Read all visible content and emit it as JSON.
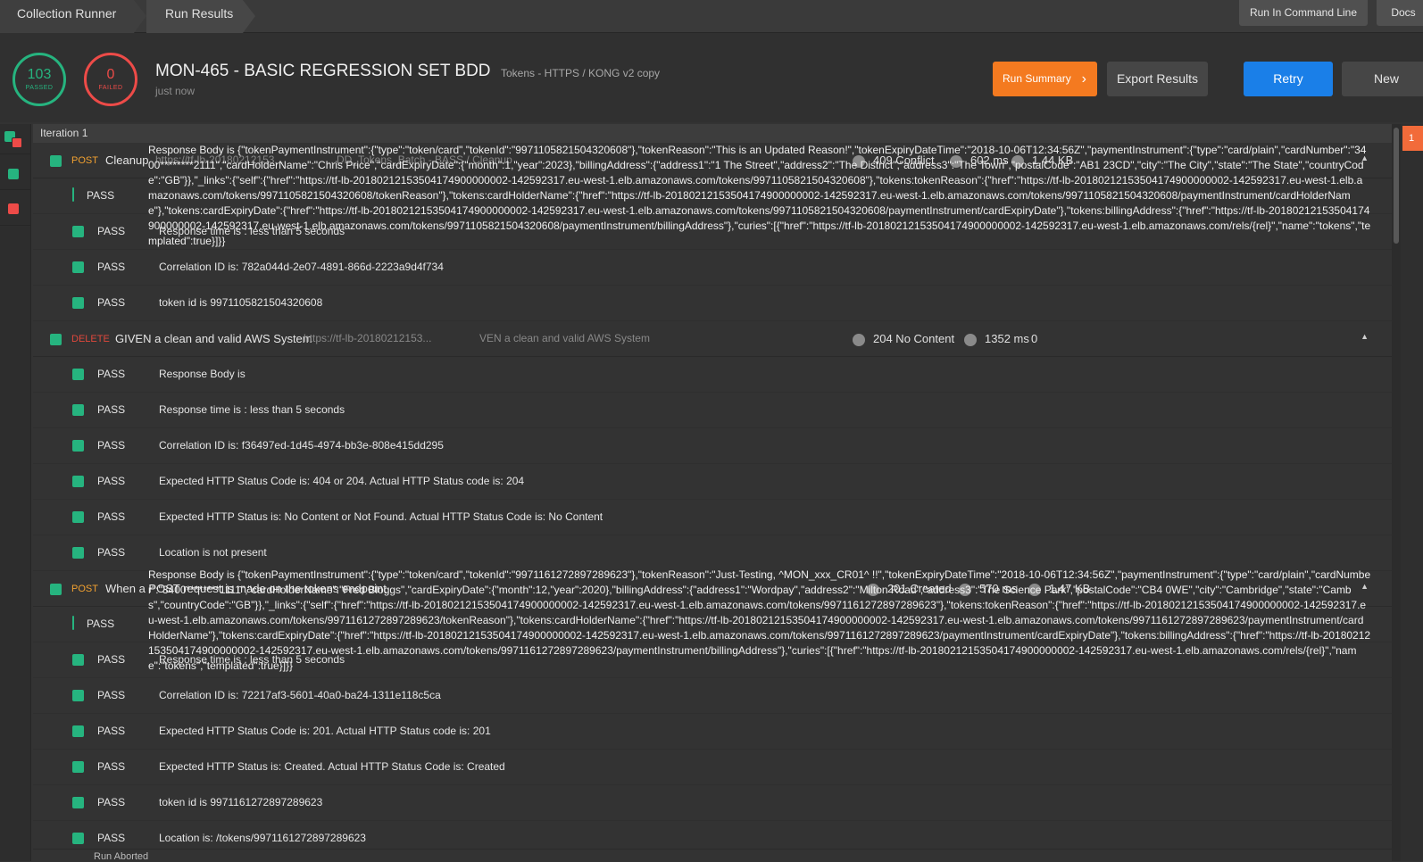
{
  "tabs": {
    "collection_runner": "Collection Runner",
    "run_results": "Run Results"
  },
  "top_buttons": {
    "run_cmd": "Run In Command Line",
    "docs": "Docs"
  },
  "summary": {
    "passed_count": "103",
    "passed_label": "PASSED",
    "failed_count": "0",
    "failed_label": "FAILED",
    "title": "MON-465 - BASIC REGRESSION SET BDD",
    "environment": "Tokens - HTTPS / KONG v2 copy",
    "time": "just now"
  },
  "buttons": {
    "run_summary": "Run Summary",
    "export": "Export Results",
    "retry": "Retry",
    "new": "New"
  },
  "iteration": "Iteration 1",
  "orange_tag": "1",
  "requests": [
    {
      "method": "POST",
      "name": "Cleanup",
      "url": "https://tf-lb-20180212153...",
      "url_tail": "...DD_Tokens_Batch - BASS / Cleanup",
      "status": "409 Conflict",
      "time": "602 ms",
      "size": "1.44 KB",
      "overlay": "Response Body is {\"tokenPaymentInstrument\":{\"type\":\"token/card\",\"tokenId\":\"9971105821504320608\"},\"tokenReason\":\"This is an Updated Reason!\",\"tokenExpiryDateTime\":\"2018-10-06T12:34:56Z\",\"paymentInstrument\":{\"type\":\"card/plain\",\"cardNumber\":\"3400********2111\",\"cardHolderName\":\"Chris Price\",\"cardExpiryDate\":{\"month\":1,\"year\":2023},\"billingAddress\":{\"address1\":\"1 The Street\",\"address2\":\"The District\",\"address3\":\"The Town\",\"postalCode\":\"AB1 23CD\",\"city\":\"The City\",\"state\":\"The State\",\"countryCode\":\"GB\"}},\"_links\":{\"self\":{\"href\":\"https://tf-lb-20180212153504174900000002-142592317.eu-west-1.elb.amazonaws.com/tokens/9971105821504320608\"},\"tokens:tokenReason\":{\"href\":\"https://tf-lb-20180212153504174900000002-142592317.eu-west-1.elb.amazonaws.com/tokens/9971105821504320608/tokenReason\"},\"tokens:cardHolderName\":{\"href\":\"https://tf-lb-20180212153504174900000002-142592317.eu-west-1.elb.amazonaws.com/tokens/9971105821504320608/paymentInstrument/cardHolderName\"},\"tokens:cardExpiryDate\":{\"href\":\"https://tf-lb-20180212153504174900000002-142592317.eu-west-1.elb.amazonaws.com/tokens/9971105821504320608/paymentInstrument/cardExpiryDate\"},\"tokens:billingAddress\":{\"href\":\"https://tf-lb-20180212153504174900000002-142592317.eu-west-1.elb.amazonaws.com/tokens/9971105821504320608/paymentInstrument/billingAddress\"},\"curies\":[{\"href\":\"https://tf-lb-20180212153504174900000002-142592317.eu-west-1.elb.amazonaws.com/rels/{rel}\",\"name\":\"tokens\",\"templated\":true}]}}",
      "tests": [
        {
          "result": "PASS",
          "name": ""
        },
        {
          "result": "PASS",
          "name": "Response time is : less than 5 seconds"
        },
        {
          "result": "PASS",
          "name": "Correlation ID is: 782a044d-2e07-4891-866d-2223a9d4f734"
        },
        {
          "result": "PASS",
          "name": "token id is 9971105821504320608"
        }
      ]
    },
    {
      "method": "DELETE",
      "name": "GIVEN a clean and valid AWS System",
      "url": "https://tf-lb-20180212153...",
      "url_tail": "VEN a clean and valid AWS System",
      "status": "204 No Content",
      "time": "1352 ms",
      "size": "0",
      "tests": [
        {
          "result": "PASS",
          "name": "Response Body is"
        },
        {
          "result": "PASS",
          "name": "Response time is : less than 5 seconds"
        },
        {
          "result": "PASS",
          "name": "Correlation ID is: f36497ed-1d45-4974-bb3e-808e415dd295"
        },
        {
          "result": "PASS",
          "name": "Expected HTTP Status Code is: 404 or 204. Actual HTTP Status code is: 204"
        },
        {
          "result": "PASS",
          "name": "Expected HTTP Status is: No Content or Not Found. Actual HTTP Status Code is: No Content"
        },
        {
          "result": "PASS",
          "name": "Location is not present"
        }
      ]
    },
    {
      "method": "POST",
      "name": "When a POST request is made on the tokens endpoint",
      "url": "",
      "url_tail": "",
      "status": "201 Created",
      "time": "570 ms",
      "size": "1.47 KB",
      "overlay": "Response Body is {\"tokenPaymentInstrument\":{\"type\":\"token/card\",\"tokenId\":\"9971161272897289623\"},\"tokenReason\":\"Just-Testing, ^MON_xxx_CR01^ !!\",\"tokenExpiryDateTime\":\"2018-10-06T12:34:56Z\",\"paymentInstrument\":{\"type\":\"card/plain\",\"cardNumber\":\"3400********1111\",\"cardHolderName\":\"Fred Bloggs\",\"cardExpiryDate\":{\"month\":12,\"year\":2020},\"billingAddress\":{\"address1\":\"Wordpay\",\"address2\":\"Milton Road\",\"address3\":\"The Science Park\",\"postalCode\":\"CB4 0WE\",\"city\":\"Cambridge\",\"state\":\"Cambs\",\"countryCode\":\"GB\"}},\"_links\":{\"self\":{\"href\":\"https://tf-lb-20180212153504174900000002-142592317.eu-west-1.elb.amazonaws.com/tokens/9971161272897289623\"},\"tokens:tokenReason\":{\"href\":\"https://tf-lb-20180212153504174900000002-142592317.eu-west-1.elb.amazonaws.com/tokens/9971161272897289623/tokenReason\"},\"tokens:cardHolderName\":{\"href\":\"https://tf-lb-20180212153504174900000002-142592317.eu-west-1.elb.amazonaws.com/tokens/9971161272897289623/paymentInstrument/cardHolderName\"},\"tokens:cardExpiryDate\":{\"href\":\"https://tf-lb-20180212153504174900000002-142592317.eu-west-1.elb.amazonaws.com/tokens/9971161272897289623/paymentInstrument/cardExpiryDate\"},\"tokens:billingAddress\":{\"href\":\"https://tf-lb-20180212153504174900000002-142592317.eu-west-1.elb.amazonaws.com/tokens/9971161272897289623/paymentInstrument/billingAddress\"},\"curies\":[{\"href\":\"https://tf-lb-20180212153504174900000002-142592317.eu-west-1.elb.amazonaws.com/rels/{rel}\",\"name\":\"tokens\",\"templated\":true}]}}",
      "tests": [
        {
          "result": "PASS",
          "name": ""
        },
        {
          "result": "PASS",
          "name": "Response time is : less than 5 seconds"
        },
        {
          "result": "PASS",
          "name": "Correlation ID is: 72217af3-5601-40a0-ba24-1311e118c5ca"
        },
        {
          "result": "PASS",
          "name": "Expected HTTP Status Code is: 201. Actual HTTP Status code is: 201"
        },
        {
          "result": "PASS",
          "name": "Expected HTTP Status is: Created. Actual HTTP Status Code is: Created"
        },
        {
          "result": "PASS",
          "name": "token id is 9971161272897289623"
        },
        {
          "result": "PASS",
          "name": "Location is: /tokens/9971161272897289623"
        }
      ]
    }
  ],
  "footer_text": "Run Aborted",
  "colors": {
    "accent_orange": "#f47a20",
    "retry_blue": "#1a7fe8",
    "pass_green": "#26b47f",
    "fail_red": "#ed4b48",
    "method_orange": "#f0a030",
    "method_red": "#e0483c"
  }
}
